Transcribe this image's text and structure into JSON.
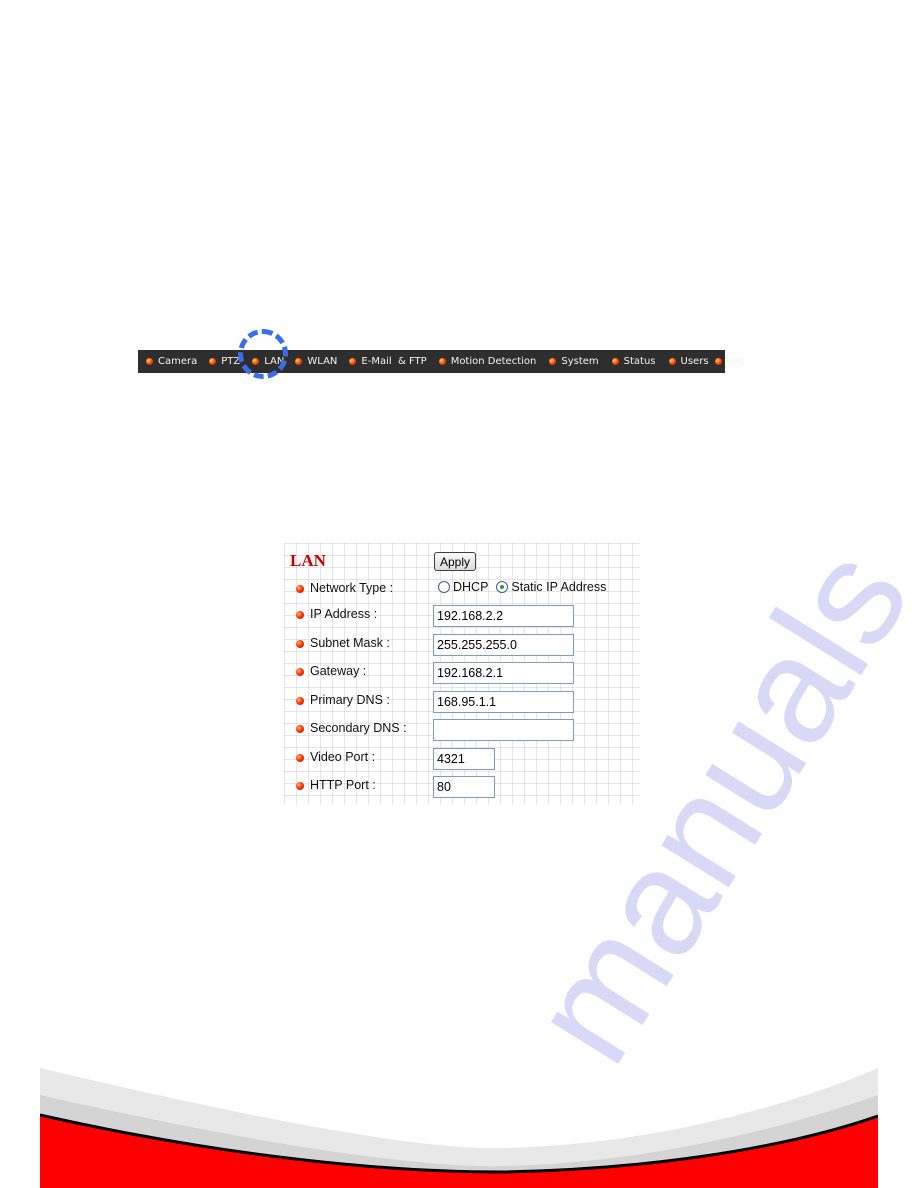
{
  "nav": {
    "items": [
      {
        "label": "Camera"
      },
      {
        "label": "PTZ"
      },
      {
        "label": "LAN"
      },
      {
        "label": "WLAN"
      },
      {
        "label": "E-Mail  & FTP"
      },
      {
        "label": "Motion Detection"
      },
      {
        "label": "System"
      },
      {
        "label": "Status"
      },
      {
        "label": "Users"
      },
      {
        "label": "Log"
      }
    ],
    "highlighted": "LAN",
    "highlight_color": "#3a6ee8",
    "bullet_color": "#ff3b00",
    "bar_color": "#2e2e2e"
  },
  "panel": {
    "title": "LAN",
    "title_color": "#c00000",
    "apply_label": "Apply",
    "network_type": {
      "label": "Network Type :",
      "options": [
        "DHCP",
        "Static IP Address"
      ],
      "selected": "Static IP Address"
    },
    "fields": [
      {
        "label": "IP Address :",
        "value": "192.168.2.2"
      },
      {
        "label": "Subnet Mask :",
        "value": "255.255.255.0"
      },
      {
        "label": "Gateway :",
        "value": "192.168.2.1"
      },
      {
        "label": "Primary DNS :",
        "value": "168.95.1.1"
      },
      {
        "label": "Secondary DNS :",
        "value": ""
      },
      {
        "label": "Video Port :",
        "value": "4321"
      },
      {
        "label": "HTTP Port :",
        "value": "80"
      }
    ]
  },
  "watermark": {
    "text": "manuals"
  },
  "footer": {
    "accent_color": "#ff0000"
  }
}
